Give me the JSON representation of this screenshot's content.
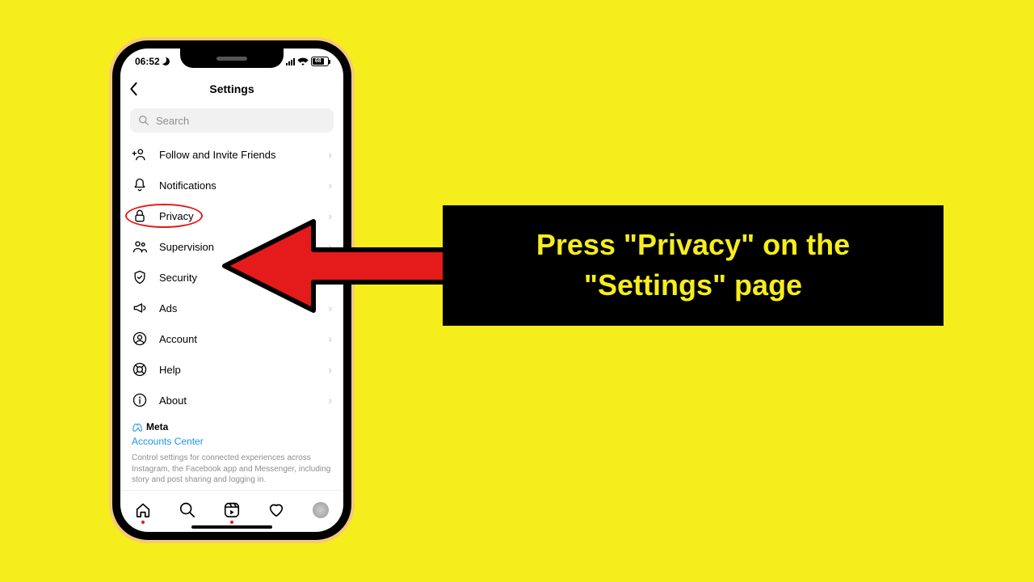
{
  "statusbar": {
    "time": "06:52",
    "battery": "68"
  },
  "header": {
    "title": "Settings"
  },
  "search": {
    "placeholder": "Search"
  },
  "items": [
    {
      "label": "Follow and Invite Friends",
      "name": "follow-invite"
    },
    {
      "label": "Notifications",
      "name": "notifications"
    },
    {
      "label": "Privacy",
      "name": "privacy",
      "highlighted": true
    },
    {
      "label": "Supervision",
      "name": "supervision"
    },
    {
      "label": "Security",
      "name": "security"
    },
    {
      "label": "Ads",
      "name": "ads"
    },
    {
      "label": "Account",
      "name": "account"
    },
    {
      "label": "Help",
      "name": "help"
    },
    {
      "label": "About",
      "name": "about"
    }
  ],
  "meta": {
    "brand": "Meta",
    "link": "Accounts Center",
    "desc": "Control settings for connected experiences across Instagram, the Facebook app and Messenger, including story and post sharing and logging in."
  },
  "callout": {
    "text": "Press \"Privacy\" on the \"Settings\" page"
  }
}
